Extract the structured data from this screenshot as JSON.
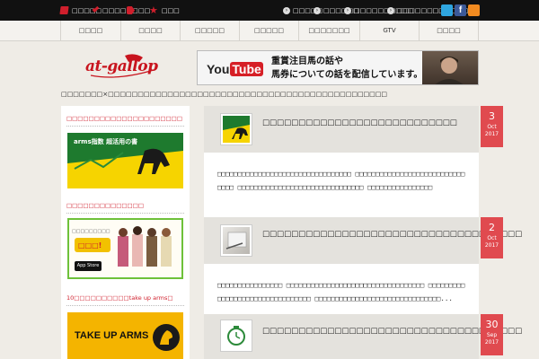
{
  "topbar": {
    "left_items": [
      {
        "label": "□□□□□",
        "icon": "pencil-icon"
      },
      {
        "label": "□□□□□□",
        "icon": "check-icon"
      },
      {
        "label": "□□",
        "icon": "tag-icon"
      },
      {
        "label": "□□□",
        "icon": "star-icon"
      }
    ],
    "right_items": [
      {
        "label": "□□□□□"
      },
      {
        "label": "□□□□□□"
      },
      {
        "label": "□□□□□□□□□□"
      },
      {
        "label": "□□□□□□□□□□□□"
      }
    ],
    "social": [
      {
        "name": "twitter-icon",
        "color": "#2fa6e0"
      },
      {
        "name": "facebook-icon",
        "color": "#3b5998"
      },
      {
        "name": "rss-icon",
        "color": "#f28b20"
      }
    ]
  },
  "nav": {
    "items": [
      "□□□□",
      "□□□□",
      "□□□□□",
      "□□□□□",
      "□□□□□□□",
      "GTV",
      "□□□□"
    ]
  },
  "header": {
    "logo_text": "at-gallop",
    "banner": {
      "brand_you": "You",
      "brand_tube": "Tube",
      "line1": "重賞注目馬の話や",
      "line2": "馬券についての話を配信しています。"
    }
  },
  "tagline": "□□□□□□□×□□□□□□□□□□□□□□□□□□□□□□□□□□□□□□□□□□□□□□□□□□□□□□□",
  "sidebar": {
    "widgets": [
      {
        "title": "□□□□□□□□□□□□□□□□□□□□□"
      },
      {
        "title": "□□□□□□□□□□□□□□"
      },
      {
        "title": "10□□□□□□□□□□take up arms□"
      }
    ],
    "banner1_text": "arms指数 超活用の書",
    "banner2_badge": "App Store",
    "banner3_text": "TAKE UP ARMS"
  },
  "posts": [
    {
      "title": "□□□□□□□□□□□□□□□□□□□□□□□□□□□",
      "excerpt": "□□□□□□□□□□□□□□□□□□□□□□□□□□□□□□□□□ □□□□□□□□□□□□□□□□□□□□□□□□□□□□□□□ □□□□□□□□□□□□□□□□□□□□□□□□□□□□□□□ □□□□□□□□□□□□□□□□",
      "day": "3",
      "month": "Oct",
      "year": "2017"
    },
    {
      "title": "□□□□□□□□□□□□□□□□□□□□□□□□□□□□□□□□□□□□",
      "excerpt": "□□□□□□□□□□□□□□□□ □□□□□□□□□□□□□□□□□□□□□□□□□□□□□□□□□□ □□□□□□□□□□□□□□□□□□□□□□□□□□□□□□□□ □□□□□□□□□□□□□□□□□□□□□□□□□□□□□□□...",
      "day": "2",
      "month": "Oct",
      "year": "2017"
    },
    {
      "title": "□□□□□□□□□□□□□□□□□□□□□□□□□□□□□□□□□□□□",
      "excerpt": "",
      "day": "30",
      "month": "Sep",
      "year": "2017"
    }
  ]
}
